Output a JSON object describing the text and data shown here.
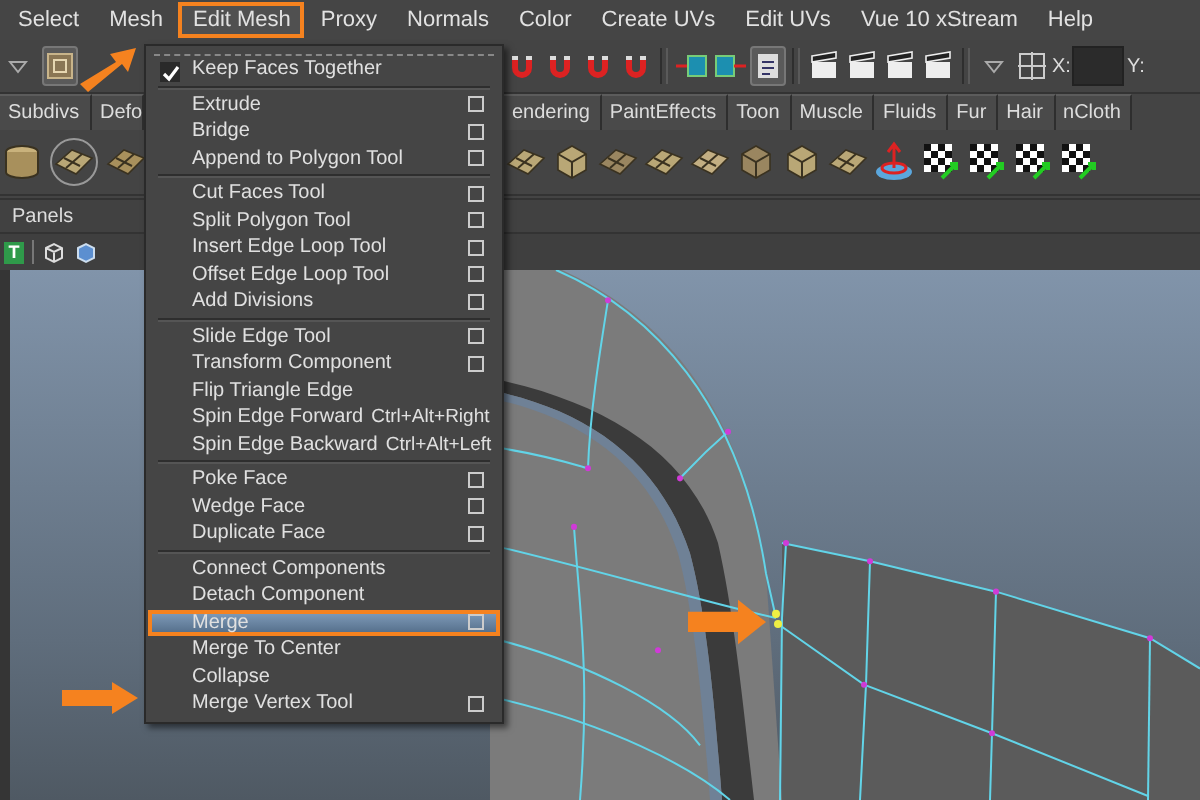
{
  "menubar": {
    "items": [
      {
        "label": "Select",
        "selected": false
      },
      {
        "label": "Mesh",
        "selected": false
      },
      {
        "label": "Edit Mesh",
        "selected": true
      },
      {
        "label": "Proxy",
        "selected": false
      },
      {
        "label": "Normals",
        "selected": false
      },
      {
        "label": "Color",
        "selected": false
      },
      {
        "label": "Create UVs",
        "selected": false
      },
      {
        "label": "Edit UVs",
        "selected": false
      },
      {
        "label": "Vue 10 xStream",
        "selected": false
      },
      {
        "label": "Help",
        "selected": false
      }
    ]
  },
  "toolbar": {
    "x_label": "X:",
    "y_label": "Y:"
  },
  "shelf_tabs": [
    "Subdivs",
    "Defo",
    "endering",
    "PaintEffects",
    "Toon",
    "Muscle",
    "Fluids",
    "Fur",
    "Hair",
    "nCloth"
  ],
  "panels_bar": {
    "label": "Panels"
  },
  "panel_toolbar": {
    "text_icon": "T"
  },
  "edit_mesh_menu": {
    "groups": [
      {
        "items": [
          {
            "label": "Keep Faces Together",
            "kind": "check",
            "checked": true,
            "selected": false
          }
        ]
      },
      {
        "items": [
          {
            "label": "Extrude",
            "kind": "option",
            "selected": false
          },
          {
            "label": "Bridge",
            "kind": "option",
            "selected": false
          },
          {
            "label": "Append to Polygon Tool",
            "kind": "option",
            "selected": false
          }
        ]
      },
      {
        "items": [
          {
            "label": "Cut Faces Tool",
            "kind": "option",
            "selected": false
          },
          {
            "label": "Split Polygon Tool",
            "kind": "option",
            "selected": false
          },
          {
            "label": "Insert Edge Loop Tool",
            "kind": "option",
            "selected": false
          },
          {
            "label": "Offset Edge Loop Tool",
            "kind": "option",
            "selected": false
          },
          {
            "label": "Add Divisions",
            "kind": "option",
            "selected": false
          }
        ]
      },
      {
        "items": [
          {
            "label": "Slide Edge Tool",
            "kind": "option",
            "selected": false
          },
          {
            "label": "Transform Component",
            "kind": "option",
            "selected": false
          },
          {
            "label": "Flip Triangle Edge",
            "kind": "plain",
            "selected": false
          },
          {
            "label": "Spin Edge Forward",
            "kind": "shortcut",
            "shortcut": "Ctrl+Alt+Right",
            "selected": false
          },
          {
            "label": "Spin Edge Backward",
            "kind": "shortcut",
            "shortcut": "Ctrl+Alt+Left",
            "selected": false
          }
        ]
      },
      {
        "items": [
          {
            "label": "Poke Face",
            "kind": "option",
            "selected": false
          },
          {
            "label": "Wedge Face",
            "kind": "option",
            "selected": false
          },
          {
            "label": "Duplicate Face",
            "kind": "option",
            "selected": false
          }
        ]
      },
      {
        "items": [
          {
            "label": "Connect Components",
            "kind": "plain",
            "selected": false
          },
          {
            "label": "Detach Component",
            "kind": "plain",
            "selected": false
          },
          {
            "label": "Merge",
            "kind": "option",
            "selected": true
          },
          {
            "label": "Merge To Center",
            "kind": "plain",
            "selected": false
          },
          {
            "label": "Collapse",
            "kind": "plain",
            "selected": false
          },
          {
            "label": "Merge Vertex Tool",
            "kind": "option",
            "selected": false
          }
        ]
      }
    ]
  }
}
